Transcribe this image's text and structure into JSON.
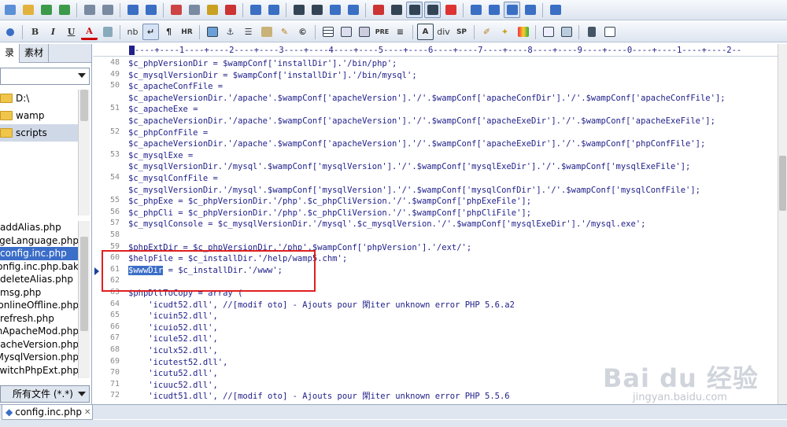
{
  "toolbar1": {
    "buttons": [
      "new-icon",
      "open-icon",
      "save-icon",
      "save-all-icon",
      "print-preview-icon",
      "print-icon",
      "spellcheck-icon",
      "code-icon",
      "cut-icon",
      "copy-icon",
      "paste-icon",
      "delete-icon",
      "undo-icon",
      "redo-icon",
      "find-icon",
      "replace-icon",
      "find-in-files-icon",
      "goto-icon",
      "font-size-icon",
      "heading-icon",
      "wordwrap-icon",
      "column-icon",
      "check-icon",
      "window-icon",
      "split-icon",
      "tile-icon",
      "cascade-icon",
      "help-icon"
    ]
  },
  "toolbar2": {
    "bold": "B",
    "italic": "I",
    "underline": "U",
    "font_color": "A",
    "nbsp": "nb",
    "paragraph": "¶",
    "hr": "HR",
    "pre": "PRE",
    "div": "div",
    "sp": "SP"
  },
  "left_panel": {
    "tabs": [
      "录",
      "素材"
    ],
    "drive_select_value": "",
    "folders": [
      "D:\\",
      "wamp",
      "scripts"
    ],
    "files": [
      "addAlias.php",
      "changeLanguage.php",
      "config.inc.php",
      "config.inc.php.bak",
      "deleteAlias.php",
      "msg.php",
      "onlineOffline.php",
      "refresh.php",
      "switchApacheMod.php",
      "switchApacheVersion.php",
      "switchMysqlVersion.php",
      "switchPhpExt.php"
    ],
    "selected_file": "config.inc.php",
    "filter_label": "所有文件 (*.*)"
  },
  "editor": {
    "ruler": "----+----1----+----2----+----3----+----4----+----5----+----6----+----7----+----8----+----9----+----0----+----1----+----2--",
    "lines": [
      {
        "num": "48",
        "text": "$c_phpVersionDir = $wampConf['installDir'].'/bin/php';"
      },
      {
        "num": "49",
        "text": "$c_mysqlVersionDir = $wampConf['installDir'].'/bin/mysql';"
      },
      {
        "num": "50",
        "text": "$c_apacheConfFile ="
      },
      {
        "num": "",
        "text": "$c_apacheVersionDir.'/apache'.$wampConf['apacheVersion'].'/'.$wampConf['apacheConfDir'].'/'.$wampConf['apacheConfFile'];"
      },
      {
        "num": "51",
        "text": "$c_apacheExe ="
      },
      {
        "num": "",
        "text": "$c_apacheVersionDir.'/apache'.$wampConf['apacheVersion'].'/'.$wampConf['apacheExeDir'].'/'.$wampConf['apacheExeFile'];"
      },
      {
        "num": "52",
        "text": "$c_phpConfFile ="
      },
      {
        "num": "",
        "text": "$c_apacheVersionDir.'/apache'.$wampConf['apacheVersion'].'/'.$wampConf['apacheExeDir'].'/'.$wampConf['phpConfFile'];"
      },
      {
        "num": "53",
        "text": "$c_mysqlExe ="
      },
      {
        "num": "",
        "text": "$c_mysqlVersionDir.'/mysql'.$wampConf['mysqlVersion'].'/'.$wampConf['mysqlExeDir'].'/'.$wampConf['mysqlExeFile'];"
      },
      {
        "num": "54",
        "text": "$c_mysqlConfFile ="
      },
      {
        "num": "",
        "text": "$c_mysqlVersionDir.'/mysql'.$wampConf['mysqlVersion'].'/'.$wampConf['mysqlConfDir'].'/'.$wampConf['mysqlConfFile'];"
      },
      {
        "num": "55",
        "text": "$c_phpExe = $c_phpVersionDir.'/php'.$c_phpCliVersion.'/'.$wampConf['phpExeFile'];"
      },
      {
        "num": "56",
        "text": "$c_phpCli = $c_phpVersionDir.'/php'.$c_phpCliVersion.'/'.$wampConf['phpCliFile'];"
      },
      {
        "num": "57",
        "text": "$c_mysqlConsole = $c_mysqlVersionDir.'/mysql'.$c_mysqlVersion.'/'.$wampConf['mysqlExeDir'].'/mysql.exe';"
      },
      {
        "num": "58",
        "text": ""
      },
      {
        "num": "59",
        "text": "$phpExtDir = $c_phpVersionDir.'/php'.$wampConf['phpVersion'].'/ext/';"
      },
      {
        "num": "60",
        "text": "$helpFile = $c_installDir.'/help/wamp5.chm';"
      },
      {
        "num": "61",
        "text": " = $c_installDir.'/www';",
        "selected": "$wwwDir"
      },
      {
        "num": "62",
        "text": ""
      },
      {
        "num": "63",
        "text": "$phpDllToCopy = array ("
      },
      {
        "num": "64",
        "text": "    'icudt52.dll', //[modif oto] - Ajouts pour 閑iter unknown error PHP 5.6.a2"
      },
      {
        "num": "65",
        "text": "    'icuin52.dll',"
      },
      {
        "num": "66",
        "text": "    'icuio52.dll',"
      },
      {
        "num": "67",
        "text": "    'icule52.dll',"
      },
      {
        "num": "68",
        "text": "    'iculx52.dll',"
      },
      {
        "num": "69",
        "text": "    'icutest52.dll',"
      },
      {
        "num": "70",
        "text": "    'icutu52.dll',"
      },
      {
        "num": "71",
        "text": "    'icuuc52.dll',"
      },
      {
        "num": "72",
        "text": "    'icudt51.dll', //[modif oto] - Ajouts pour 閑iter unknown error PHP 5.5.6"
      }
    ]
  },
  "doc_tab": {
    "label": "config.inc.php"
  },
  "watermark": {
    "brand": "Bai du 经验",
    "url": "jingyan.baidu.com"
  },
  "colors": {
    "code": "#20208a",
    "selection": "#3b6ec8",
    "annotation": "#e02020"
  }
}
